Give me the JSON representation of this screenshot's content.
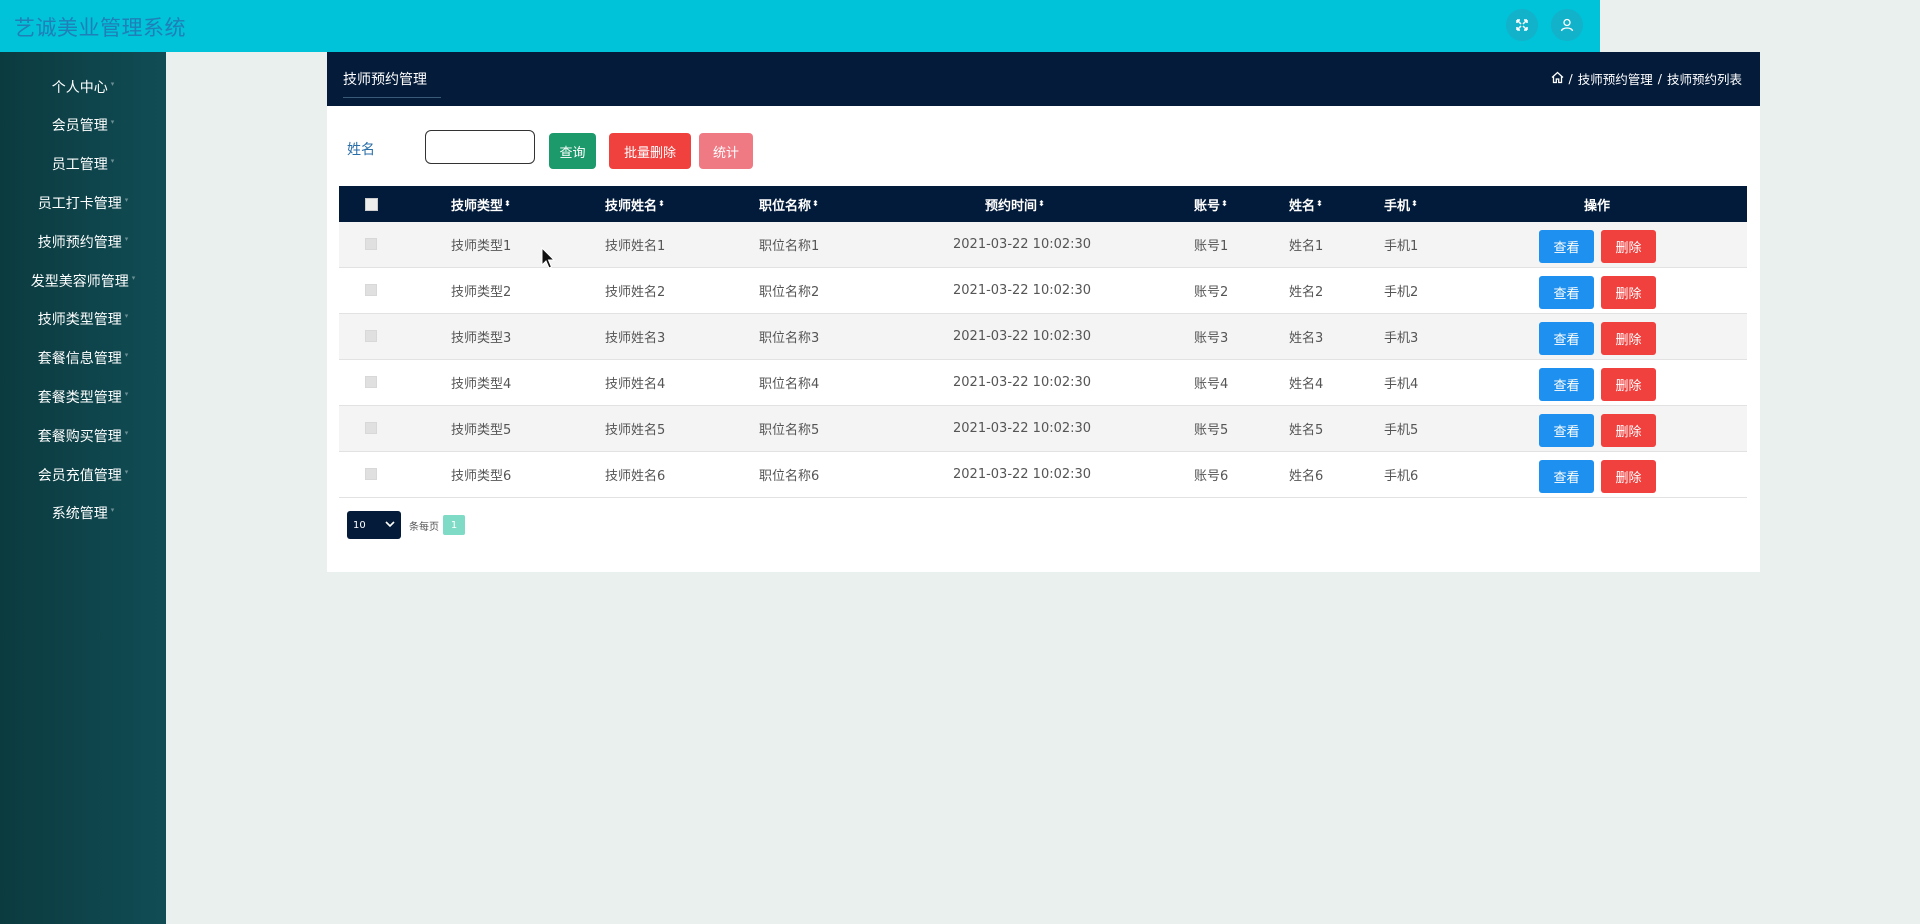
{
  "app": {
    "title": "艺诚美业管理系统"
  },
  "top_icons": [
    {
      "name": "fullscreen-icon"
    },
    {
      "name": "user-icon"
    }
  ],
  "sidebar": {
    "items": [
      {
        "label": "个人中心"
      },
      {
        "label": "会员管理"
      },
      {
        "label": "员工管理"
      },
      {
        "label": "员工打卡管理"
      },
      {
        "label": "技师预约管理"
      },
      {
        "label": "发型美容师管理"
      },
      {
        "label": "技师类型管理"
      },
      {
        "label": "套餐信息管理"
      },
      {
        "label": "套餐类型管理"
      },
      {
        "label": "套餐购买管理"
      },
      {
        "label": "会员充值管理"
      },
      {
        "label": "系统管理"
      }
    ]
  },
  "panel": {
    "title": "技师预约管理",
    "breadcrumb": [
      "技师预约管理",
      "技师预约列表"
    ],
    "breadcrumb_sep": "/"
  },
  "search": {
    "label": "姓名",
    "value": "",
    "query_button": "查询",
    "batch_delete_button": "批量删除",
    "stats_button": "统计"
  },
  "colors": {
    "topbar": "#00c2d8",
    "header": "#041b3a",
    "query": "#1d9a6c",
    "danger": "#f0413f",
    "stats": "#f07a84",
    "view": "#1e90f0"
  },
  "table": {
    "columns": [
      "技师类型",
      "技师姓名",
      "职位名称",
      "预约时间",
      "账号",
      "姓名",
      "手机",
      "操作"
    ],
    "rows": [
      {
        "type": "技师类型1",
        "tech_name": "技师姓名1",
        "position": "职位名称1",
        "time": "2021-03-22 10:02:30",
        "account": "账号1",
        "name": "姓名1",
        "phone": "手机1"
      },
      {
        "type": "技师类型2",
        "tech_name": "技师姓名2",
        "position": "职位名称2",
        "time": "2021-03-22 10:02:30",
        "account": "账号2",
        "name": "姓名2",
        "phone": "手机2"
      },
      {
        "type": "技师类型3",
        "tech_name": "技师姓名3",
        "position": "职位名称3",
        "time": "2021-03-22 10:02:30",
        "account": "账号3",
        "name": "姓名3",
        "phone": "手机3"
      },
      {
        "type": "技师类型4",
        "tech_name": "技师姓名4",
        "position": "职位名称4",
        "time": "2021-03-22 10:02:30",
        "account": "账号4",
        "name": "姓名4",
        "phone": "手机4"
      },
      {
        "type": "技师类型5",
        "tech_name": "技师姓名5",
        "position": "职位名称5",
        "time": "2021-03-22 10:02:30",
        "account": "账号5",
        "name": "姓名5",
        "phone": "手机5"
      },
      {
        "type": "技师类型6",
        "tech_name": "技师姓名6",
        "position": "职位名称6",
        "time": "2021-03-22 10:02:30",
        "account": "账号6",
        "name": "姓名6",
        "phone": "手机6"
      }
    ],
    "view_label": "查看",
    "delete_label": "删除"
  },
  "pagination": {
    "page_size": "10",
    "per_page_label": "条每页",
    "current_page": "1"
  }
}
